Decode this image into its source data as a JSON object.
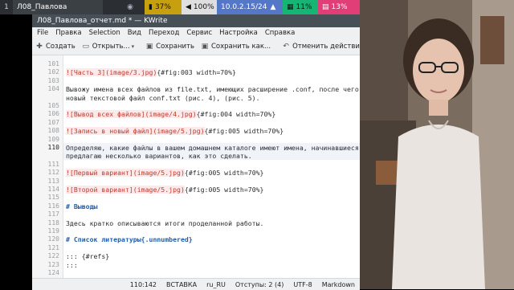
{
  "topbar": {
    "workspace": "1",
    "window_title": "Л08_Павлова",
    "battery": "37%",
    "volume": "100%",
    "ip": "10.0.2.15/24",
    "cpu": "11%",
    "mem": "13%"
  },
  "window": {
    "title": "Л08_Павлова_отчет.md * — KWrite"
  },
  "menu": [
    "File",
    "Правка",
    "Selection",
    "Вид",
    "Переход",
    "Сервис",
    "Настройка",
    "Справка"
  ],
  "toolbar": {
    "create": "Создать",
    "open": "Открыть...",
    "save": "Сохранить",
    "save_as": "Сохранить как...",
    "undo": "Отменить действие"
  },
  "editor": {
    "lines": [
      {
        "n": "101",
        "text": ""
      },
      {
        "n": "102",
        "text": "![Часть 3](image/3.jpg)",
        "tail": "{#fig:003 width=70%}",
        "kind": "img"
      },
      {
        "n": "103",
        "text": ""
      },
      {
        "n": "104",
        "text": "Вывожу имена всех файлов из file.txt, имеющих расширение .conf, после чего записываю их в"
      },
      {
        "n": "",
        "text": "новый текстовой файл conf.txt (рис. 4), (рис. 5)."
      },
      {
        "n": "105",
        "text": ""
      },
      {
        "n": "106",
        "text": "![Вывод всех файлов](image/4.jpg)",
        "tail": "{#fig:004 width=70%}",
        "kind": "img"
      },
      {
        "n": "107",
        "text": ""
      },
      {
        "n": "108",
        "text": "![Запись в новый файл](image/5.jpg)",
        "tail": "{#fig:005 width=70%}",
        "kind": "img"
      },
      {
        "n": "109",
        "text": ""
      },
      {
        "n": "110",
        "text": "Определяю, какие файлы в вашем домашнем каталоге имеют имена, начинавшиеся с символа c. Также",
        "kind": "cur"
      },
      {
        "n": "",
        "text": "предлагаю несколько вариантов, как это сделать."
      },
      {
        "n": "111",
        "text": ""
      },
      {
        "n": "112",
        "text": "![Первый вариант](image/5.jpg)",
        "tail": "{#fig:005 width=70%}",
        "kind": "img"
      },
      {
        "n": "113",
        "text": ""
      },
      {
        "n": "114",
        "text": "![Второй вариант](image/5.jpg)",
        "tail": "{#fig:005 width=70%}",
        "kind": "img"
      },
      {
        "n": "115",
        "text": ""
      },
      {
        "n": "116",
        "text": "# Выводы",
        "kind": "hdr"
      },
      {
        "n": "117",
        "text": ""
      },
      {
        "n": "118",
        "text": "Здесь кратко описываются итоги проделанной работы."
      },
      {
        "n": "119",
        "text": ""
      },
      {
        "n": "120",
        "text": "# Список литературы{.unnumbered}",
        "kind": "hdr"
      },
      {
        "n": "121",
        "text": ""
      },
      {
        "n": "122",
        "text": "::: {#refs}"
      },
      {
        "n": "123",
        "text": ":::"
      },
      {
        "n": "124",
        "text": ""
      }
    ]
  },
  "status": {
    "position": "110:142",
    "mode": "ВСТАВКА",
    "lang": "ru_RU",
    "indent": "Отступы: 2 (4)",
    "encoding": "UTF-8",
    "syntax": "Markdown"
  }
}
